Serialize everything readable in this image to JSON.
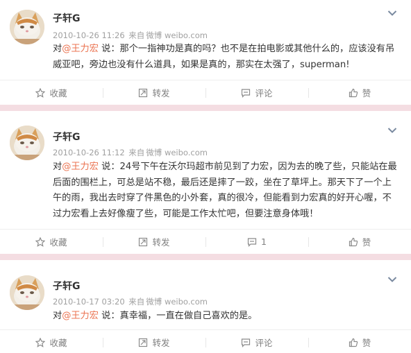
{
  "posts": [
    {
      "user": "子轩G",
      "time": "2010-10-26 11:26",
      "source_prefix": "来自",
      "source": "微博 weibo.com",
      "reply_prefix": "对",
      "mention": "@王力宏",
      "reply_suffix": " 说：",
      "text": "那个一指神功是真的吗？也不是在拍电影或其他什么的，应该没有吊威亚吧，旁边也没有什么道具，如果是真的，那实在太强了，superman!",
      "actions": {
        "favorite": "收藏",
        "forward": "转发",
        "comment": "评论",
        "like": "赞"
      }
    },
    {
      "user": "子轩G",
      "time": "2010-10-26 11:12",
      "source_prefix": "来自",
      "source": "微博 weibo.com",
      "reply_prefix": "对",
      "mention": "@王力宏",
      "reply_suffix": " 说：",
      "text": "24号下午在沃尔玛超市前见到了力宏，因为去的晚了些，只能站在最后面的围栏上，可总是站不稳，最后还是摔了一跤，坐在了草坪上。那天下了一个上午的雨，我出去时穿了件黑色的小外套，真的很冷，但能看到力宏真的好开心喔，不过力宏看上去好像瘦了些，可能是工作太忙吧，但要注意身体哦！",
      "actions": {
        "favorite": "收藏",
        "forward": "转发",
        "comment": "1",
        "like": "赞"
      }
    },
    {
      "user": "子轩G",
      "time": "2010-10-17 03:20",
      "source_prefix": "来自",
      "source": "微博 weibo.com",
      "reply_prefix": "对",
      "mention": "@王力宏",
      "reply_suffix": " 说：",
      "text": "真幸福，一直在做自己喜欢的是。",
      "actions": {
        "favorite": "收藏",
        "forward": "转发",
        "comment": "评论",
        "like": "赞"
      }
    }
  ],
  "colors": {
    "mention": "#eb7350",
    "separator": "#f4dde2",
    "meta_text": "#a0a0a0",
    "action_text": "#808080"
  },
  "icons": [
    "avatar-kitten",
    "chevron-down-icon",
    "star-icon",
    "forward-icon",
    "comment-icon",
    "thumbs-up-icon"
  ]
}
